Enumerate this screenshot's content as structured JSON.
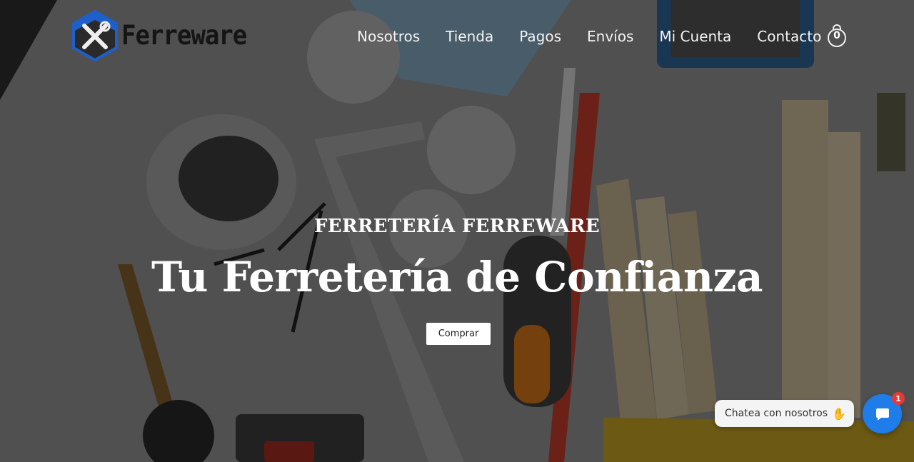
{
  "brand": {
    "name": "Ferreware"
  },
  "nav": {
    "items": [
      {
        "label": "Nosotros"
      },
      {
        "label": "Tienda"
      },
      {
        "label": "Pagos"
      },
      {
        "label": "Envíos"
      },
      {
        "label": "Mi Cuenta"
      },
      {
        "label": "Contacto"
      }
    ]
  },
  "cart": {
    "count": "0",
    "icon": "shopping-bag-icon"
  },
  "hero": {
    "subtitle": "FERRETERÍA FERREWARE",
    "title": "Tu Ferretería de Confianza",
    "button_label": "Comprar"
  },
  "chat": {
    "bubble_text": "Chatea con nosotros",
    "bubble_icon": "waving-hand-icon",
    "button_icon": "chat-icon",
    "badge_count": "1"
  },
  "colors": {
    "brand_blue": "#1e5fc9",
    "chat_blue": "#1e7de8",
    "badge_red": "#e53935"
  }
}
